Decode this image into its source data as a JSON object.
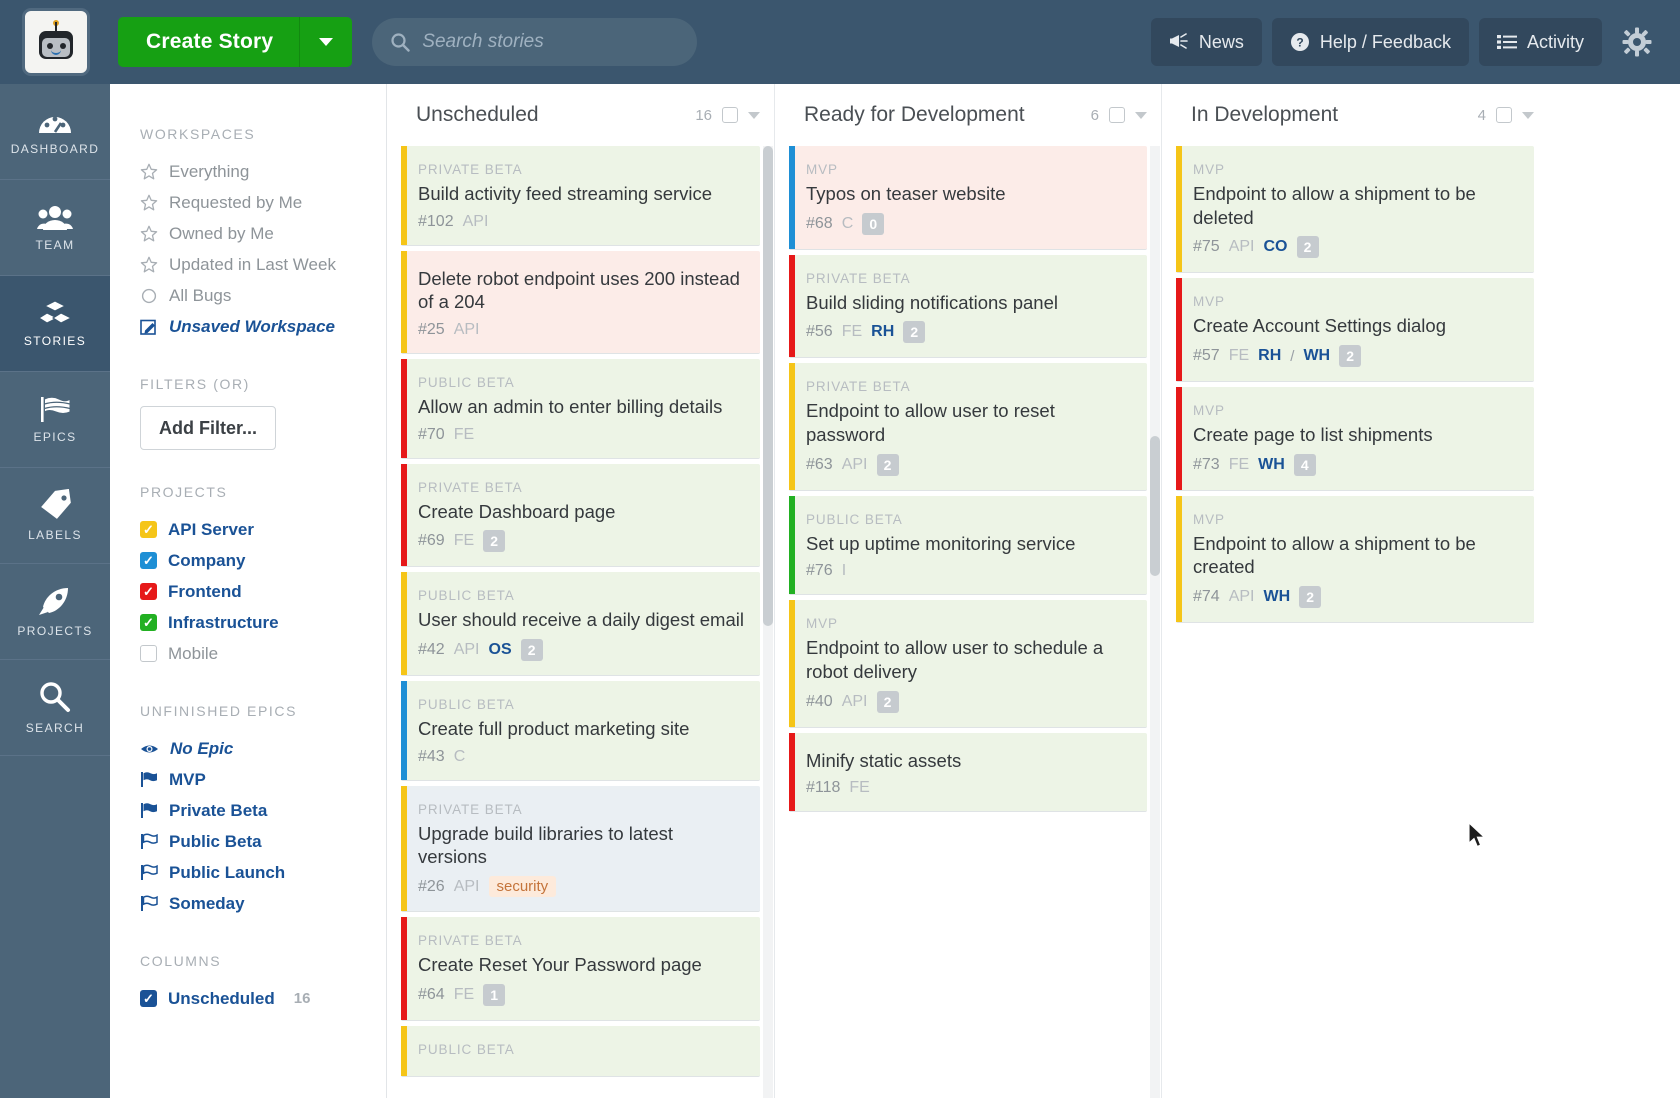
{
  "header": {
    "logo_alt": "robot-logo",
    "create_button": "Create Story",
    "search_placeholder": "Search stories",
    "news": "News",
    "help": "Help / Feedback",
    "activity": "Activity"
  },
  "rail": [
    {
      "label": "DASHBOARD",
      "icon": "dashboard-icon",
      "active": false
    },
    {
      "label": "TEAM",
      "icon": "team-icon",
      "active": false
    },
    {
      "label": "STORIES",
      "icon": "stories-icon",
      "active": true
    },
    {
      "label": "EPICS",
      "icon": "epics-icon",
      "active": false
    },
    {
      "label": "LABELS",
      "icon": "labels-icon",
      "active": false
    },
    {
      "label": "PROJECTS",
      "icon": "projects-icon",
      "active": false
    },
    {
      "label": "SEARCH",
      "icon": "search-icon",
      "active": false
    }
  ],
  "filters": {
    "workspaces_title": "WORKSPACES",
    "workspaces": [
      {
        "label": "Everything",
        "icon": "star-outline-icon",
        "style": "muted"
      },
      {
        "label": "Requested by Me",
        "icon": "star-outline-icon",
        "style": "muted"
      },
      {
        "label": "Owned by Me",
        "icon": "star-outline-icon",
        "style": "muted"
      },
      {
        "label": "Updated in Last Week",
        "icon": "star-outline-icon",
        "style": "muted"
      },
      {
        "label": "All Bugs",
        "icon": "circle-outline-icon",
        "style": "muted"
      },
      {
        "label": "Unsaved Workspace",
        "icon": "edit-pencil-icon",
        "style": "blue-i"
      }
    ],
    "filters_title": "FILTERS (OR)",
    "add_filter": "Add Filter...",
    "projects_title": "PROJECTS",
    "projects": [
      {
        "label": "API Server",
        "color": "#f5c518",
        "checked": true
      },
      {
        "label": "Company",
        "color": "#1e8fd5",
        "checked": true
      },
      {
        "label": "Frontend",
        "color": "#e61919",
        "checked": true
      },
      {
        "label": "Infrastructure",
        "color": "#22b022",
        "checked": true
      },
      {
        "label": "Mobile",
        "color": "#ffffff",
        "checked": false
      }
    ],
    "epics_title": "UNFINISHED EPICS",
    "epics": [
      {
        "label": "No Epic",
        "icon": "eye-icon",
        "italic": true
      },
      {
        "label": "MVP",
        "icon": "flag-filled-icon",
        "italic": false
      },
      {
        "label": "Private Beta",
        "icon": "flag-filled-icon",
        "italic": false
      },
      {
        "label": "Public Beta",
        "icon": "flag-outline-icon",
        "italic": false
      },
      {
        "label": "Public Launch",
        "icon": "flag-outline-icon",
        "italic": false
      },
      {
        "label": "Someday",
        "icon": "flag-outline-icon",
        "italic": false
      }
    ],
    "columns_title": "COLUMNS",
    "columns": [
      {
        "label": "Unscheduled",
        "count": "16",
        "checked": true
      }
    ]
  },
  "board": {
    "columns": [
      {
        "title": "Unscheduled",
        "count": "16",
        "cards": [
          {
            "epic": "PRIVATE BETA",
            "title": "Build activity feed streaming service",
            "id": "#102",
            "project": "API",
            "owners": [],
            "estimate": "",
            "label": "",
            "stripe": "#f5c518",
            "bg": "#edf4e6"
          },
          {
            "epic": "",
            "title": "Delete robot endpoint uses 200 instead of a 204",
            "id": "#25",
            "project": "API",
            "owners": [],
            "estimate": "",
            "label": "",
            "stripe": "#f5c518",
            "bg": "#fcece8"
          },
          {
            "epic": "PUBLIC BETA",
            "title": "Allow an admin to enter billing details",
            "id": "#70",
            "project": "FE",
            "owners": [],
            "estimate": "",
            "label": "",
            "stripe": "#e61919",
            "bg": "#edf4e6"
          },
          {
            "epic": "PRIVATE BETA",
            "title": "Create Dashboard page",
            "id": "#69",
            "project": "FE",
            "owners": [],
            "estimate": "2",
            "label": "",
            "stripe": "#e61919",
            "bg": "#edf4e6"
          },
          {
            "epic": "PUBLIC BETA",
            "title": "User should receive a daily digest email",
            "id": "#42",
            "project": "API",
            "owners": [
              "OS"
            ],
            "estimate": "2",
            "label": "",
            "stripe": "#f5c518",
            "bg": "#edf4e6"
          },
          {
            "epic": "PUBLIC BETA",
            "title": "Create full product marketing site",
            "id": "#43",
            "project": "C",
            "owners": [],
            "estimate": "",
            "label": "",
            "stripe": "#1e8fd5",
            "bg": "#edf4e6"
          },
          {
            "epic": "PRIVATE BETA",
            "title": "Upgrade build libraries to latest versions",
            "id": "#26",
            "project": "API",
            "owners": [],
            "estimate": "",
            "label": "security",
            "stripe": "#f5c518",
            "bg": "#eaeff3"
          },
          {
            "epic": "PRIVATE BETA",
            "title": "Create Reset Your Password page",
            "id": "#64",
            "project": "FE",
            "owners": [],
            "estimate": "1",
            "label": "",
            "stripe": "#e61919",
            "bg": "#edf4e6"
          },
          {
            "epic": "PUBLIC BETA",
            "title": "",
            "id": "",
            "project": "",
            "owners": [],
            "estimate": "",
            "label": "",
            "stripe": "#f5c518",
            "bg": "#edf4e6"
          }
        ]
      },
      {
        "title": "Ready for Development",
        "count": "6",
        "cards": [
          {
            "epic": "MVP",
            "title": "Typos on teaser website",
            "id": "#68",
            "project": "C",
            "owners": [],
            "estimate": "0",
            "label": "",
            "stripe": "#1e8fd5",
            "bg": "#fcece8"
          },
          {
            "epic": "PRIVATE BETA",
            "title": "Build sliding notifications panel",
            "id": "#56",
            "project": "FE",
            "owners": [
              "RH"
            ],
            "estimate": "2",
            "label": "",
            "stripe": "#e61919",
            "bg": "#edf4e6"
          },
          {
            "epic": "PRIVATE BETA",
            "title": "Endpoint to allow user to reset password",
            "id": "#63",
            "project": "API",
            "owners": [],
            "estimate": "2",
            "label": "",
            "stripe": "#f5c518",
            "bg": "#edf4e6"
          },
          {
            "epic": "PUBLIC BETA",
            "title": "Set up uptime monitoring service",
            "id": "#76",
            "project": "I",
            "owners": [],
            "estimate": "",
            "label": "",
            "stripe": "#22b022",
            "bg": "#edf4e6"
          },
          {
            "epic": "MVP",
            "title": "Endpoint to allow user to schedule a robot delivery",
            "id": "#40",
            "project": "API",
            "owners": [],
            "estimate": "2",
            "label": "",
            "stripe": "#f5c518",
            "bg": "#edf4e6"
          },
          {
            "epic": "",
            "title": "Minify static assets",
            "id": "#118",
            "project": "FE",
            "owners": [],
            "estimate": "",
            "label": "",
            "stripe": "#e61919",
            "bg": "#edf4e6"
          }
        ]
      },
      {
        "title": "In Development",
        "count": "4",
        "cards": [
          {
            "epic": "MVP",
            "title": "Endpoint to allow a shipment to be deleted",
            "id": "#75",
            "project": "API",
            "owners": [
              "CO"
            ],
            "estimate": "2",
            "label": "",
            "stripe": "#f5c518",
            "bg": "#edf4e6"
          },
          {
            "epic": "MVP",
            "title": "Create Account Settings dialog",
            "id": "#57",
            "project": "FE",
            "owners": [
              "RH",
              "WH"
            ],
            "estimate": "2",
            "label": "",
            "stripe": "#e61919",
            "bg": "#edf4e6"
          },
          {
            "epic": "MVP",
            "title": "Create page to list shipments",
            "id": "#73",
            "project": "FE",
            "owners": [
              "WH"
            ],
            "estimate": "4",
            "label": "",
            "stripe": "#e61919",
            "bg": "#edf4e6"
          },
          {
            "epic": "MVP",
            "title": "Endpoint to allow a shipment to be created",
            "id": "#74",
            "project": "API",
            "owners": [
              "WH"
            ],
            "estimate": "2",
            "label": "",
            "stripe": "#f5c518",
            "bg": "#edf4e6"
          }
        ]
      }
    ]
  }
}
